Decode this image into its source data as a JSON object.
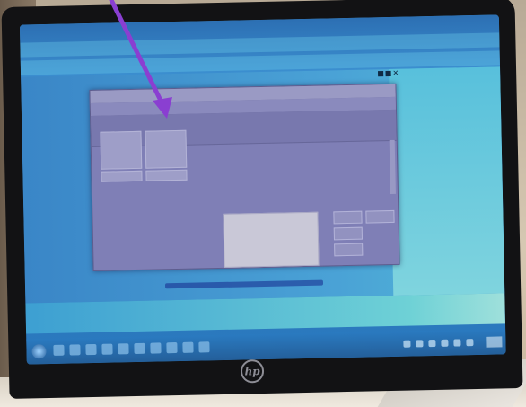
{
  "brand": {
    "logo_text": "hp"
  },
  "dialog": {
    "title": "",
    "buttons": [
      "",
      "",
      "",
      ""
    ]
  },
  "footer": {
    "text": ""
  },
  "annotation": {
    "arrow_color": "#8a3fd1"
  },
  "colors": {
    "screen_bg": "#2f7fc6",
    "dialog_bg": "#7f7fb6",
    "taskbar": "#245f9a",
    "bezel": "#121214"
  },
  "icons": [
    "start-icon",
    "taskbar-app-icon",
    "tray-icon",
    "hp-logo"
  ]
}
